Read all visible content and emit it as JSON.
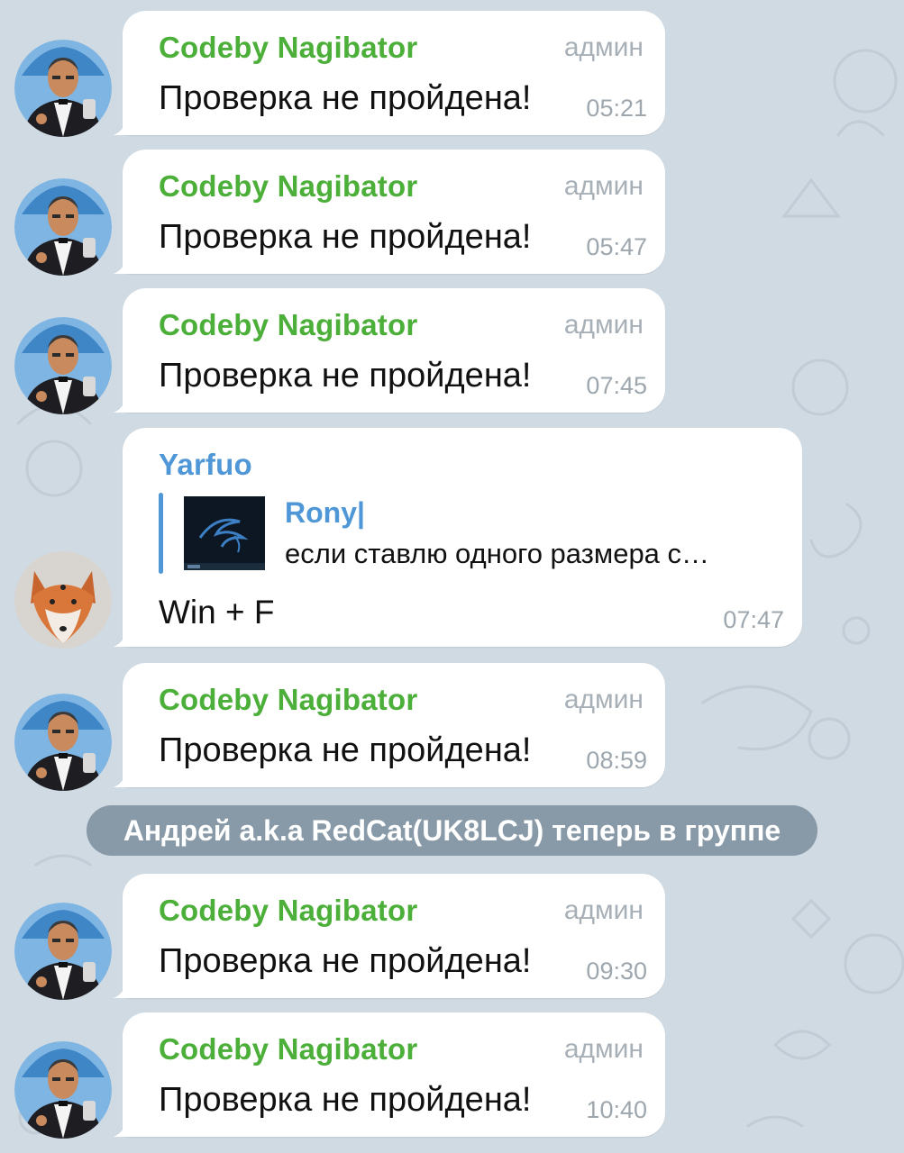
{
  "colors": {
    "background": "#d0dae3",
    "admin_name": "#4caf3a",
    "reply_author": "#4f97d6",
    "bubble": "#ffffff"
  },
  "messages": [
    {
      "sender": "Codeby Nagibator",
      "role": "админ",
      "text": "Проверка не пройдена!",
      "time": "05:21",
      "avatar": "godfather-avatar"
    },
    {
      "sender": "Codeby Nagibator",
      "role": "админ",
      "text": "Проверка не пройдена!",
      "time": "05:47",
      "avatar": "godfather-avatar"
    },
    {
      "sender": "Codeby Nagibator",
      "role": "админ",
      "text": "Проверка не пройдена!",
      "time": "07:45",
      "avatar": "godfather-avatar"
    },
    {
      "sender": "Yarfuo",
      "avatar": "fox-avatar",
      "reply": {
        "author": "Rony|",
        "text": "если ставлю одного размера с…",
        "thumb": "kali-dragon-thumbnail"
      },
      "text": "Win + F",
      "time": "07:47"
    },
    {
      "sender": "Codeby Nagibator",
      "role": "админ",
      "text": "Проверка не пройдена!",
      "time": "08:59",
      "avatar": "godfather-avatar"
    },
    {
      "sender": "Codeby Nagibator",
      "role": "админ",
      "text": "Проверка не пройдена!",
      "time": "09:30",
      "avatar": "godfather-avatar"
    },
    {
      "sender": "Codeby Nagibator",
      "role": "админ",
      "text": "Проверка не пройдена!",
      "time": "10:40",
      "avatar": "godfather-avatar"
    }
  ],
  "service_message": "Андрей a.k.a RedCat(UK8LCJ) теперь в группе"
}
